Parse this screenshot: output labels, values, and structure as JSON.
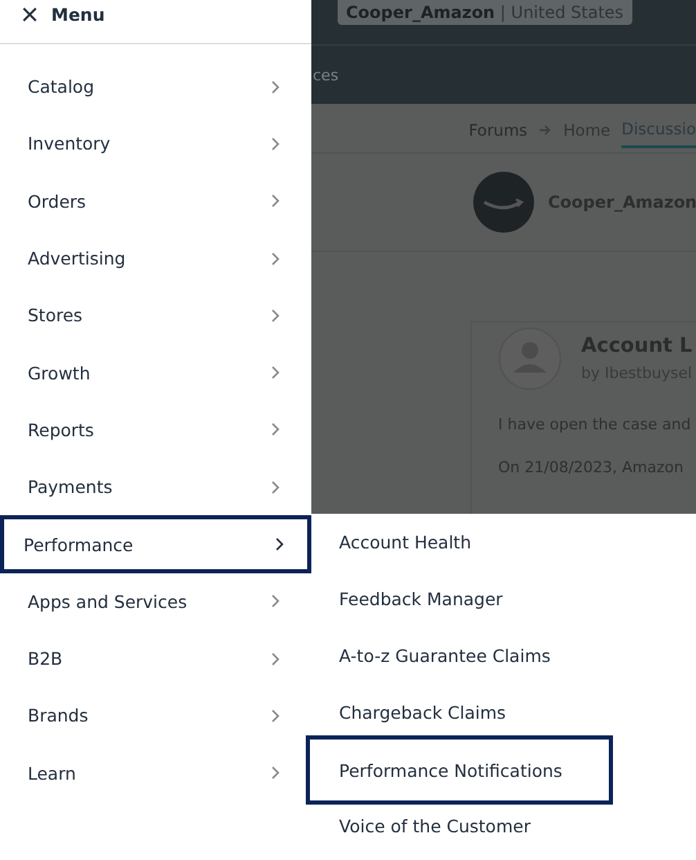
{
  "background_page": {
    "account_label": "**Cooper_Amazon** | United States",
    "nav_text": "ces",
    "breadcrumbs": [
      "Forums",
      "Home"
    ],
    "tabs": [
      {
        "label": "Discussio",
        "selected": true
      }
    ],
    "profile_name": "Cooper_Amazon",
    "post": {
      "title": "Account L",
      "byline": "by Ibestbuysel",
      "paragraphs": [
        "I have open the case and",
        "On 21/08/2023, Amazon"
      ]
    }
  },
  "menu": {
    "title": "Menu",
    "items": [
      {
        "label": "Catalog",
        "highlighted": false
      },
      {
        "label": "Inventory",
        "highlighted": false
      },
      {
        "label": "Orders",
        "highlighted": false
      },
      {
        "label": "Advertising",
        "highlighted": false
      },
      {
        "label": "Stores",
        "highlighted": false
      },
      {
        "label": "Growth",
        "highlighted": false
      },
      {
        "label": "Reports",
        "highlighted": false
      },
      {
        "label": "Payments",
        "highlighted": false
      },
      {
        "label": "Performance",
        "highlighted": true
      },
      {
        "label": "Apps and Services",
        "highlighted": false
      },
      {
        "label": "B2B",
        "highlighted": false
      },
      {
        "label": "Brands",
        "highlighted": false
      },
      {
        "label": "Learn",
        "highlighted": false
      }
    ]
  },
  "submenu": {
    "items": [
      {
        "label": "Account Health",
        "highlighted": false
      },
      {
        "label": "Feedback Manager",
        "highlighted": false
      },
      {
        "label": "A-to-z Guarantee Claims",
        "highlighted": false
      },
      {
        "label": "Chargeback Claims",
        "highlighted": false
      },
      {
        "label": "Performance Notifications",
        "highlighted": true
      },
      {
        "label": "Voice of the Customer",
        "highlighted": false
      }
    ]
  }
}
